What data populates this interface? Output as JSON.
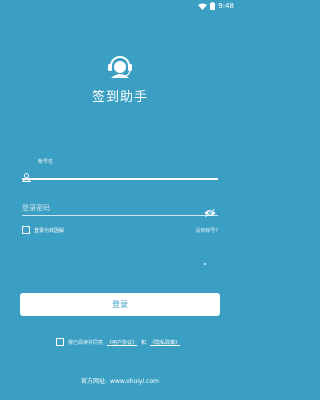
{
  "status_bar": {
    "time": "9:48"
  },
  "app": {
    "title": "签到助手"
  },
  "account": {
    "label": "帐号名",
    "value": ""
  },
  "password": {
    "placeholder": "登录密码"
  },
  "remember": {
    "label": "登录为双因解"
  },
  "no_account": "没有帐号?",
  "login_button": "登录",
  "agreement": {
    "text": "我已阅读并同意",
    "user_agreement": "《用户协议》",
    "and": "和",
    "privacy_policy": "《隐私政策》"
  },
  "footer": {
    "label": "官方网址:",
    "url": "www.ohuiyi.com"
  },
  "colors": {
    "background": "#3b9fc3",
    "foreground": "#ffffff"
  },
  "icons": [
    "wifi-icon",
    "battery-icon",
    "headset-logo-icon",
    "user-icon",
    "eye-off-icon"
  ]
}
